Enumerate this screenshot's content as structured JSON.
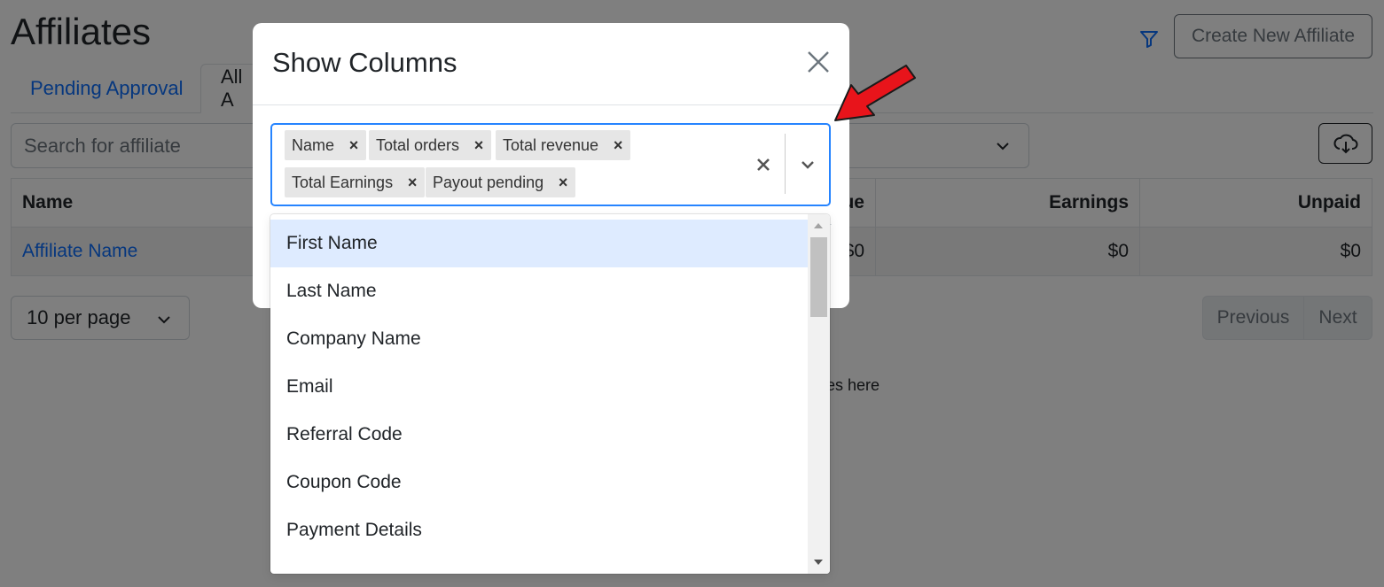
{
  "page": {
    "title": "Affiliates",
    "create_button": "Create New Affiliate",
    "tabs": [
      {
        "label": "Pending Approval"
      },
      {
        "label": "All A"
      }
    ],
    "search_placeholder": "Search for affiliate",
    "table": {
      "headers": [
        "Name",
        "ue",
        "Earnings",
        "Unpaid"
      ],
      "rows": [
        {
          "name": "Affiliate Name",
          "revenue": "$0",
          "earnings": "$0",
          "unpaid": "$0"
        }
      ]
    },
    "per_page": "10 per page",
    "pagination": {
      "previous": "Previous",
      "next": "Next"
    },
    "hint_text": "es here"
  },
  "modal": {
    "title": "Show Columns",
    "selected": [
      {
        "label": "Name"
      },
      {
        "label": "Total orders"
      },
      {
        "label": "Total revenue"
      },
      {
        "label": "Total Earnings"
      },
      {
        "label": "Payout pending"
      }
    ],
    "chip_remove_glyph": "×",
    "options": [
      {
        "label": "First Name"
      },
      {
        "label": "Last Name"
      },
      {
        "label": "Company Name"
      },
      {
        "label": "Email"
      },
      {
        "label": "Referral Code"
      },
      {
        "label": "Coupon Code"
      },
      {
        "label": "Payment Details"
      }
    ]
  },
  "colors": {
    "accent": "#0d6efd",
    "focus_border": "#2684ff",
    "option_focus": "#deebff",
    "annotation_arrow": "#e8141b"
  },
  "icons": [
    "filter-icon",
    "download-cloud-icon",
    "close-icon",
    "clear-icon",
    "chevron-down-icon",
    "red-arrow-annotation"
  ]
}
